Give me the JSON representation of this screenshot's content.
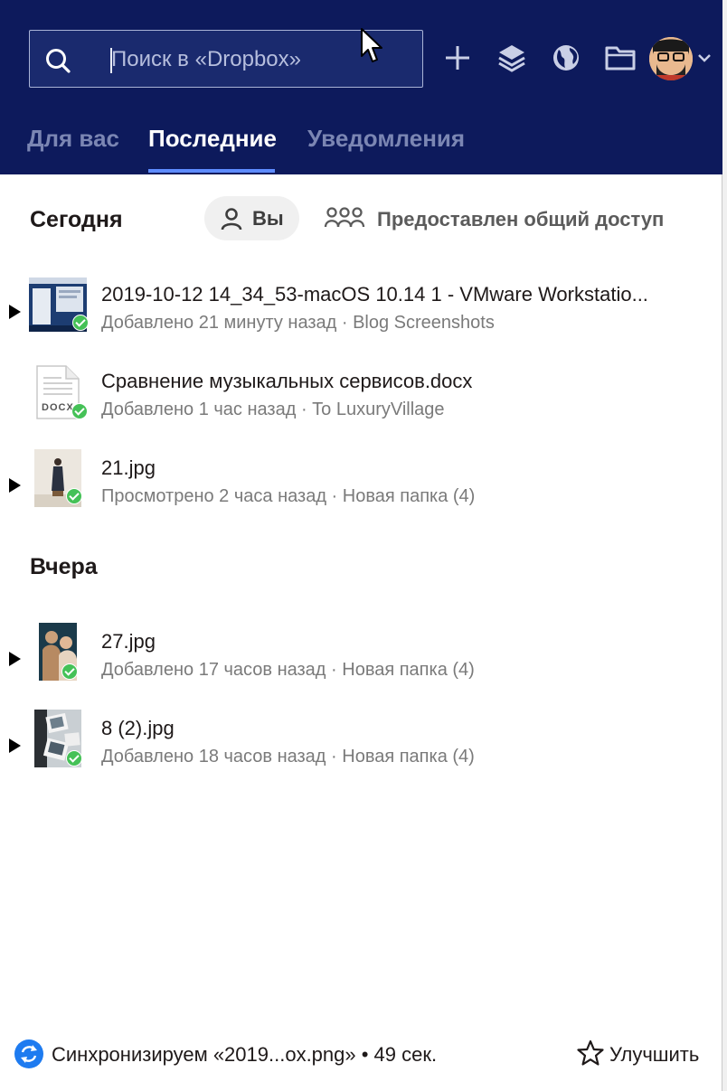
{
  "search": {
    "placeholder": "Поиск в «Dropbox»"
  },
  "header_icons": [
    "plus-icon",
    "layers-icon",
    "globe-icon",
    "folder-icon"
  ],
  "tabs": [
    {
      "label": "Для вас"
    },
    {
      "label": "Последние",
      "active": true
    },
    {
      "label": "Уведомления"
    }
  ],
  "filters": {
    "you": "Вы",
    "shared": "Предоставлен общий доступ"
  },
  "sections": [
    {
      "title": "Сегодня",
      "items": [
        {
          "name": "2019-10-12 14_34_53-macOS 10.14 1 - VMware Workstatio...",
          "meta": "Добавлено 21 минуту назад · Blog Screenshots",
          "expandable": true,
          "thumb": "screenshot"
        },
        {
          "name": "Сравнение музыкальных сервисов.docx",
          "meta": "Добавлено 1 час назад · To LuxuryVillage",
          "expandable": false,
          "thumb": "docx"
        },
        {
          "name": "21.jpg",
          "meta": "Просмотрено 2 часа назад · Новая папка (4)",
          "expandable": true,
          "thumb": "photo-person"
        }
      ]
    },
    {
      "title": "Вчера",
      "items": [
        {
          "name": "27.jpg",
          "meta": "Добавлено 17 часов назад · Новая папка (4)",
          "expandable": true,
          "thumb": "photo-group"
        },
        {
          "name": "8 (2).jpg",
          "meta": "Добавлено 18 часов назад · Новая папка (4)",
          "expandable": true,
          "thumb": "photo-cards"
        }
      ]
    }
  ],
  "docx_badge": "DOCX",
  "footer": {
    "sync_text": "Синхронизируем «2019...ox.png» • 49 сек.",
    "upgrade_label": "Улучшить"
  },
  "colors": {
    "header": "#0d1a5c",
    "accent": "#5e8cff",
    "check": "#45c157",
    "sync": "#1e7bf0"
  }
}
